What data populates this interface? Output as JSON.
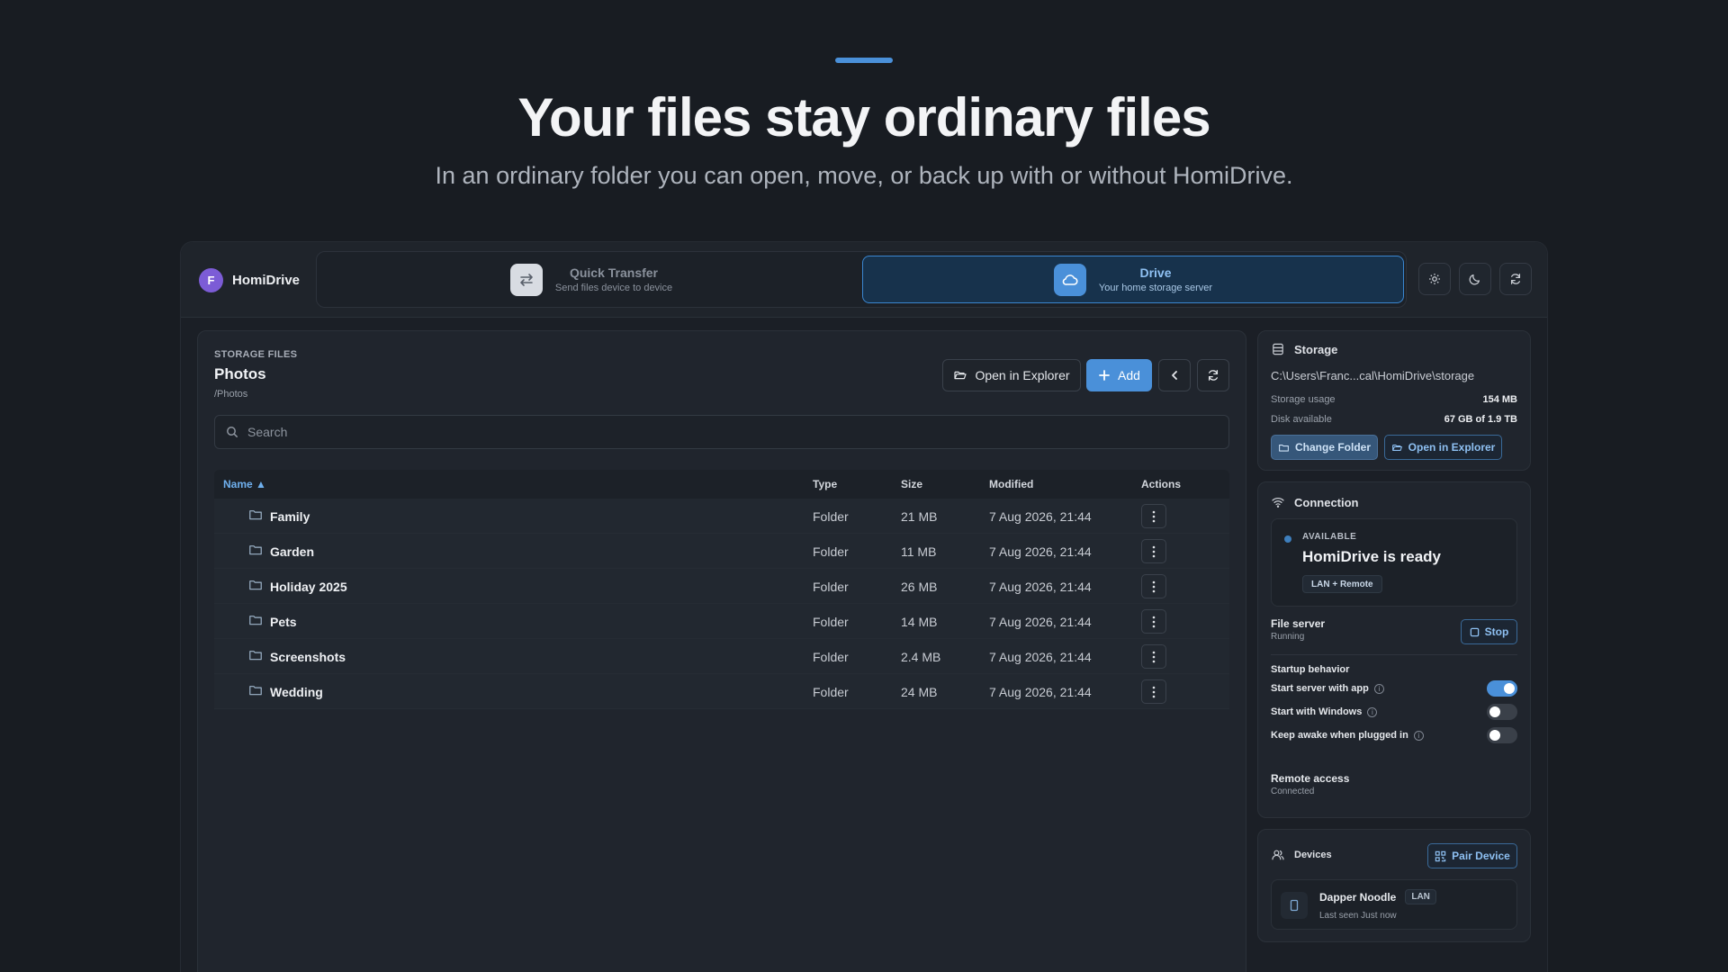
{
  "hero": {
    "title": "Your files stay ordinary files",
    "subtitle": "In an ordinary folder you can open, move, or back up with or without HomiDrive."
  },
  "app": {
    "avatar_letter": "F",
    "name": "HomiDrive"
  },
  "modes": [
    {
      "title": "Quick Transfer",
      "subtitle": "Send files device to device",
      "icon": "transfer-icon",
      "active": false
    },
    {
      "title": "Drive",
      "subtitle": "Your home storage server",
      "icon": "cloud-icon",
      "active": true
    }
  ],
  "toolbar_icons": [
    "gear-icon",
    "moon-icon",
    "refresh-icon"
  ],
  "files": {
    "section_label": "STORAGE FILES",
    "title": "Photos",
    "path": "/Photos",
    "open_explorer_label": "Open in Explorer",
    "add_label": "Add",
    "search_placeholder": "Search",
    "columns": {
      "name": "Name ▲",
      "type": "Type",
      "size": "Size",
      "modified": "Modified",
      "actions": "Actions"
    },
    "rows": [
      {
        "name": "Family",
        "type": "Folder",
        "size": "21 MB",
        "modified": "7 Aug 2026, 21:44"
      },
      {
        "name": "Garden",
        "type": "Folder",
        "size": "11 MB",
        "modified": "7 Aug 2026, 21:44"
      },
      {
        "name": "Holiday 2025",
        "type": "Folder",
        "size": "26 MB",
        "modified": "7 Aug 2026, 21:44"
      },
      {
        "name": "Pets",
        "type": "Folder",
        "size": "14 MB",
        "modified": "7 Aug 2026, 21:44"
      },
      {
        "name": "Screenshots",
        "type": "Folder",
        "size": "2.4 MB",
        "modified": "7 Aug 2026, 21:44"
      },
      {
        "name": "Wedding",
        "type": "Folder",
        "size": "24 MB",
        "modified": "7 Aug 2026, 21:44"
      }
    ]
  },
  "storage": {
    "title": "Storage",
    "path": "C:\\Users\\Franc...cal\\HomiDrive\\storage",
    "usage_label": "Storage usage",
    "usage_value": "154 MB",
    "disk_label": "Disk available",
    "disk_value": "67 GB of 1.9 TB",
    "change_folder_label": "Change Folder",
    "open_explorer_label": "Open in Explorer"
  },
  "connection": {
    "title": "Connection",
    "status_label": "AVAILABLE",
    "status_title": "HomiDrive is ready",
    "badge": "LAN + Remote",
    "file_server_label": "File server",
    "file_server_status": "Running",
    "stop_label": "Stop",
    "startup_label": "Startup behavior",
    "options": [
      {
        "label": "Start server with app",
        "on": true
      },
      {
        "label": "Start with Windows",
        "on": false
      },
      {
        "label": "Keep awake when plugged in",
        "on": false
      }
    ],
    "remote_label": "Remote access",
    "remote_status": "Connected"
  },
  "devices": {
    "title": "Devices",
    "pair_label": "Pair Device",
    "items": [
      {
        "name": "Dapper Noodle",
        "badge": "LAN",
        "last_seen": "Last seen Just now"
      }
    ]
  },
  "colors": {
    "accent": "#4a90d9",
    "background": "#181c22",
    "panel": "#20252d"
  }
}
